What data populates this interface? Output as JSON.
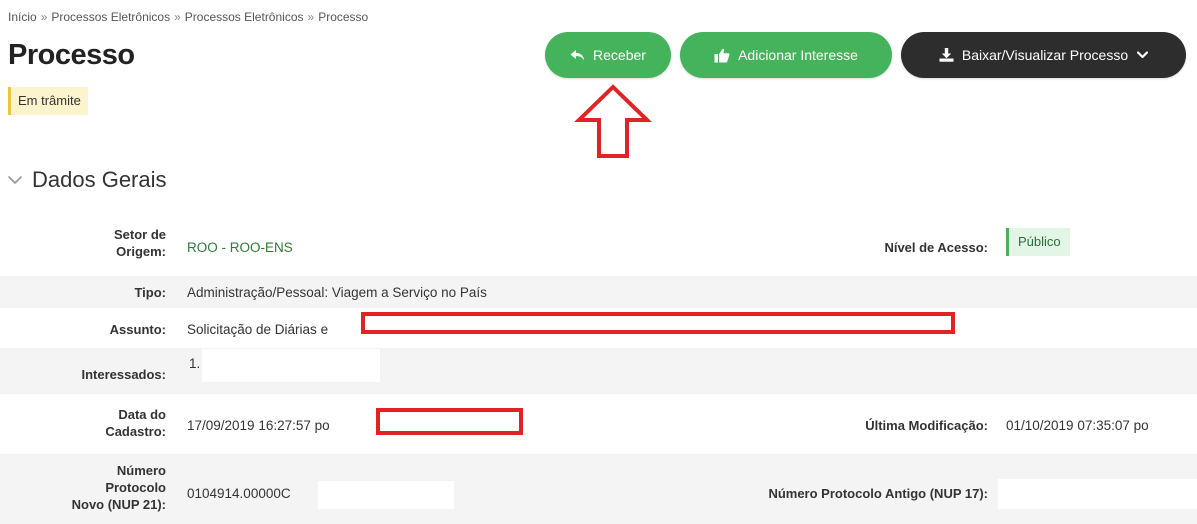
{
  "breadcrumb": {
    "items": [
      "Início",
      "Processos Eletrônicos",
      "Processos Eletrônicos",
      "Processo"
    ],
    "separator": "»"
  },
  "page_title": "Processo",
  "status_badge": "Em trâmite",
  "toolbar": {
    "receber_label": "Receber",
    "interesse_label": "Adicionar Interesse",
    "baixar_label": "Baixar/Visualizar Processo"
  },
  "section": {
    "title": "Dados Gerais"
  },
  "fields": {
    "setor_origem_label_1": "Setor de",
    "setor_origem_label_2": "Origem:",
    "setor_origem_value": "ROO - ROO-ENS",
    "nivel_acesso_label": "Nível de Acesso:",
    "nivel_acesso_value": "Público",
    "tipo_label": "Tipo:",
    "tipo_value": "Administração/Pessoal: Viagem a Serviço no País",
    "assunto_label": "Assunto:",
    "assunto_value": "Solicitação de Diárias e",
    "interessados_label": "Interessados:",
    "interessados_value": "1.",
    "data_cadastro_label_1": "Data do",
    "data_cadastro_label_2": "Cadastro:",
    "data_cadastro_value": "17/09/2019 16:27:57 po",
    "ultima_mod_label": "Última Modificação:",
    "ultima_mod_value": "01/10/2019 07:35:07 po",
    "nup21_label_1": "Número",
    "nup21_label_2": "Protocolo",
    "nup21_label_3": "Novo (NUP 21):",
    "nup21_value": "0104914.00000C",
    "nup17_label": "Número Protocolo Antigo (NUP 17):",
    "nup17_value": ""
  },
  "colors": {
    "green_button": "#45b35c",
    "dark_button": "#2d2d2d",
    "annotation_red": "#e02424",
    "status_yellow": "#fcf4cc",
    "link_green": "#2e7d32"
  },
  "icons": {
    "receber": "reply-icon",
    "interesse": "thumbs-up-icon",
    "baixar": "download-icon",
    "baixar_caret": "chevron-down-icon",
    "section_toggle": "chevron-down-icon",
    "annotation": "arrow-up-annotation"
  }
}
